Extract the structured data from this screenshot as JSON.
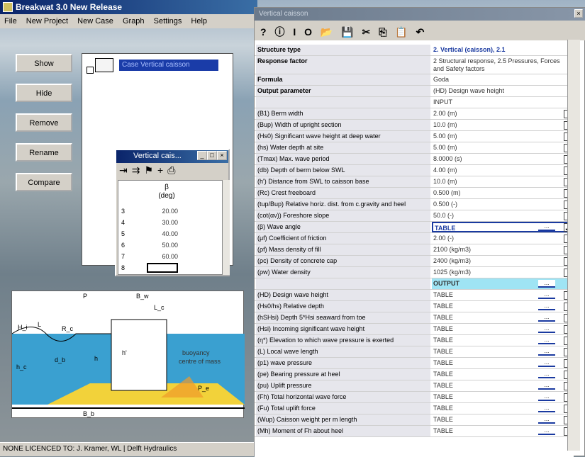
{
  "main": {
    "title": "Breakwat 3.0 New Release",
    "menu": [
      "File",
      "New Project",
      "New Case",
      "Graph",
      "Settings",
      "Help"
    ],
    "buttons": [
      "Show",
      "Hide",
      "Remove",
      "Rename",
      "Compare"
    ],
    "case_label": "Case Vertical caisson",
    "status": "NONE  LICENCED TO: J. Kramer, WL | Delft Hydraulics"
  },
  "mini_window": {
    "title": "Vertical cais...",
    "col_header": "β",
    "col_unit": "(deg)",
    "rows": [
      {
        "n": "3",
        "v": "20.00"
      },
      {
        "n": "4",
        "v": "30.00"
      },
      {
        "n": "5",
        "v": "40.00"
      },
      {
        "n": "6",
        "v": "50.00"
      },
      {
        "n": "7",
        "v": "60.00"
      },
      {
        "n": "8",
        "v": ""
      }
    ]
  },
  "sketch": {
    "labels": [
      "P",
      "B_w",
      "L_c",
      "H_i",
      "L",
      "R_c",
      "h_c",
      "d_b",
      "h",
      "h'",
      "buoyancy",
      "centre of mass",
      "P_e",
      "B_b"
    ]
  },
  "vc": {
    "title": "Vertical caisson",
    "rows": [
      {
        "label": "Structure type",
        "value": "2. Vertical (caisson), 2.1",
        "kind": "head"
      },
      {
        "label": "Response factor",
        "value": "2 Structural response, 2.5 Pressures, Forces and Safety factors",
        "kind": "tall"
      },
      {
        "label": "Formula",
        "value": "Goda",
        "kind": "plain"
      },
      {
        "label": "Output parameter",
        "value": "(HD) Design wave height",
        "kind": "plain"
      },
      {
        "label": "",
        "value": "INPUT",
        "kind": "plain"
      },
      {
        "label": "(B1) Berm width",
        "value": "2.00 (m)",
        "kind": "chk"
      },
      {
        "label": "(Bup) Width of upright section",
        "value": "10.0 (m)",
        "kind": "chk"
      },
      {
        "label": "(Hs0) Significant wave height at deep water",
        "value": "5.00 (m)",
        "kind": "chk"
      },
      {
        "label": "(hs) Water depth at site",
        "value": "5.00 (m)",
        "kind": "chk"
      },
      {
        "label": "(Tmax) Max. wave period",
        "value": "8.0000 (s)",
        "kind": "chk"
      },
      {
        "label": "(db) Depth of berm below SWL",
        "value": "4.00 (m)",
        "kind": "chk"
      },
      {
        "label": "(h') Distance from SWL to caisson base",
        "value": "10.0 (m)",
        "kind": "chk"
      },
      {
        "label": "(Rc) Crest freeboard",
        "value": "0.500 (m)",
        "kind": "chk"
      },
      {
        "label": "(tup/Bup) Relative horiz. dist. from c.gravity and heel",
        "value": "0.500 (-)",
        "kind": "chk"
      },
      {
        "label": "(cot(αv)) Foreshore slope",
        "value": "50.0 (-)",
        "kind": "chk"
      },
      {
        "label": "(β) Wave angle",
        "value": "TABLE",
        "kind": "sel"
      },
      {
        "label": "(μf) Coefficient of friction",
        "value": "2.00 (-)",
        "kind": "chk"
      },
      {
        "label": "(ρf) Mass density of fill",
        "value": "2100 (kg/m3)",
        "kind": "chk"
      },
      {
        "label": "(ρc) Density of concrete cap",
        "value": "2400 (kg/m3)",
        "kind": "chk"
      },
      {
        "label": "(ρw) Water density",
        "value": "1025 (kg/m3)",
        "kind": "chk"
      },
      {
        "label": "",
        "value": "OUTPUT",
        "kind": "outp"
      },
      {
        "label": "(HD) Design wave height",
        "value": "TABLE",
        "kind": "out"
      },
      {
        "label": "(Hs0/hs) Relative depth",
        "value": "TABLE",
        "kind": "out"
      },
      {
        "label": "(hSHsi) Depth 5*Hsi seaward from toe",
        "value": "TABLE",
        "kind": "out"
      },
      {
        "label": "(Hsi) Incoming significant wave height",
        "value": "TABLE",
        "kind": "out"
      },
      {
        "label": "(η*) Elevation to which wave pressure is exerted",
        "value": "TABLE",
        "kind": "out"
      },
      {
        "label": "(L) Local wave length",
        "value": "TABLE",
        "kind": "out"
      },
      {
        "label": "(p1) wave pressure",
        "value": "TABLE",
        "kind": "out"
      },
      {
        "label": "(pe) Bearing pressure at heel",
        "value": "TABLE",
        "kind": "out"
      },
      {
        "label": "(pu) Uplift pressure",
        "value": "TABLE",
        "kind": "out"
      },
      {
        "label": "(Fh) Total horizontal wave force",
        "value": "TABLE",
        "kind": "out"
      },
      {
        "label": "(Fu) Total uplift force",
        "value": "TABLE",
        "kind": "out"
      },
      {
        "label": "(Wup) Caisson weight per m length",
        "value": "TABLE",
        "kind": "out"
      },
      {
        "label": "(Mh) Moment of Fh about heel",
        "value": "TABLE",
        "kind": "out"
      }
    ]
  }
}
